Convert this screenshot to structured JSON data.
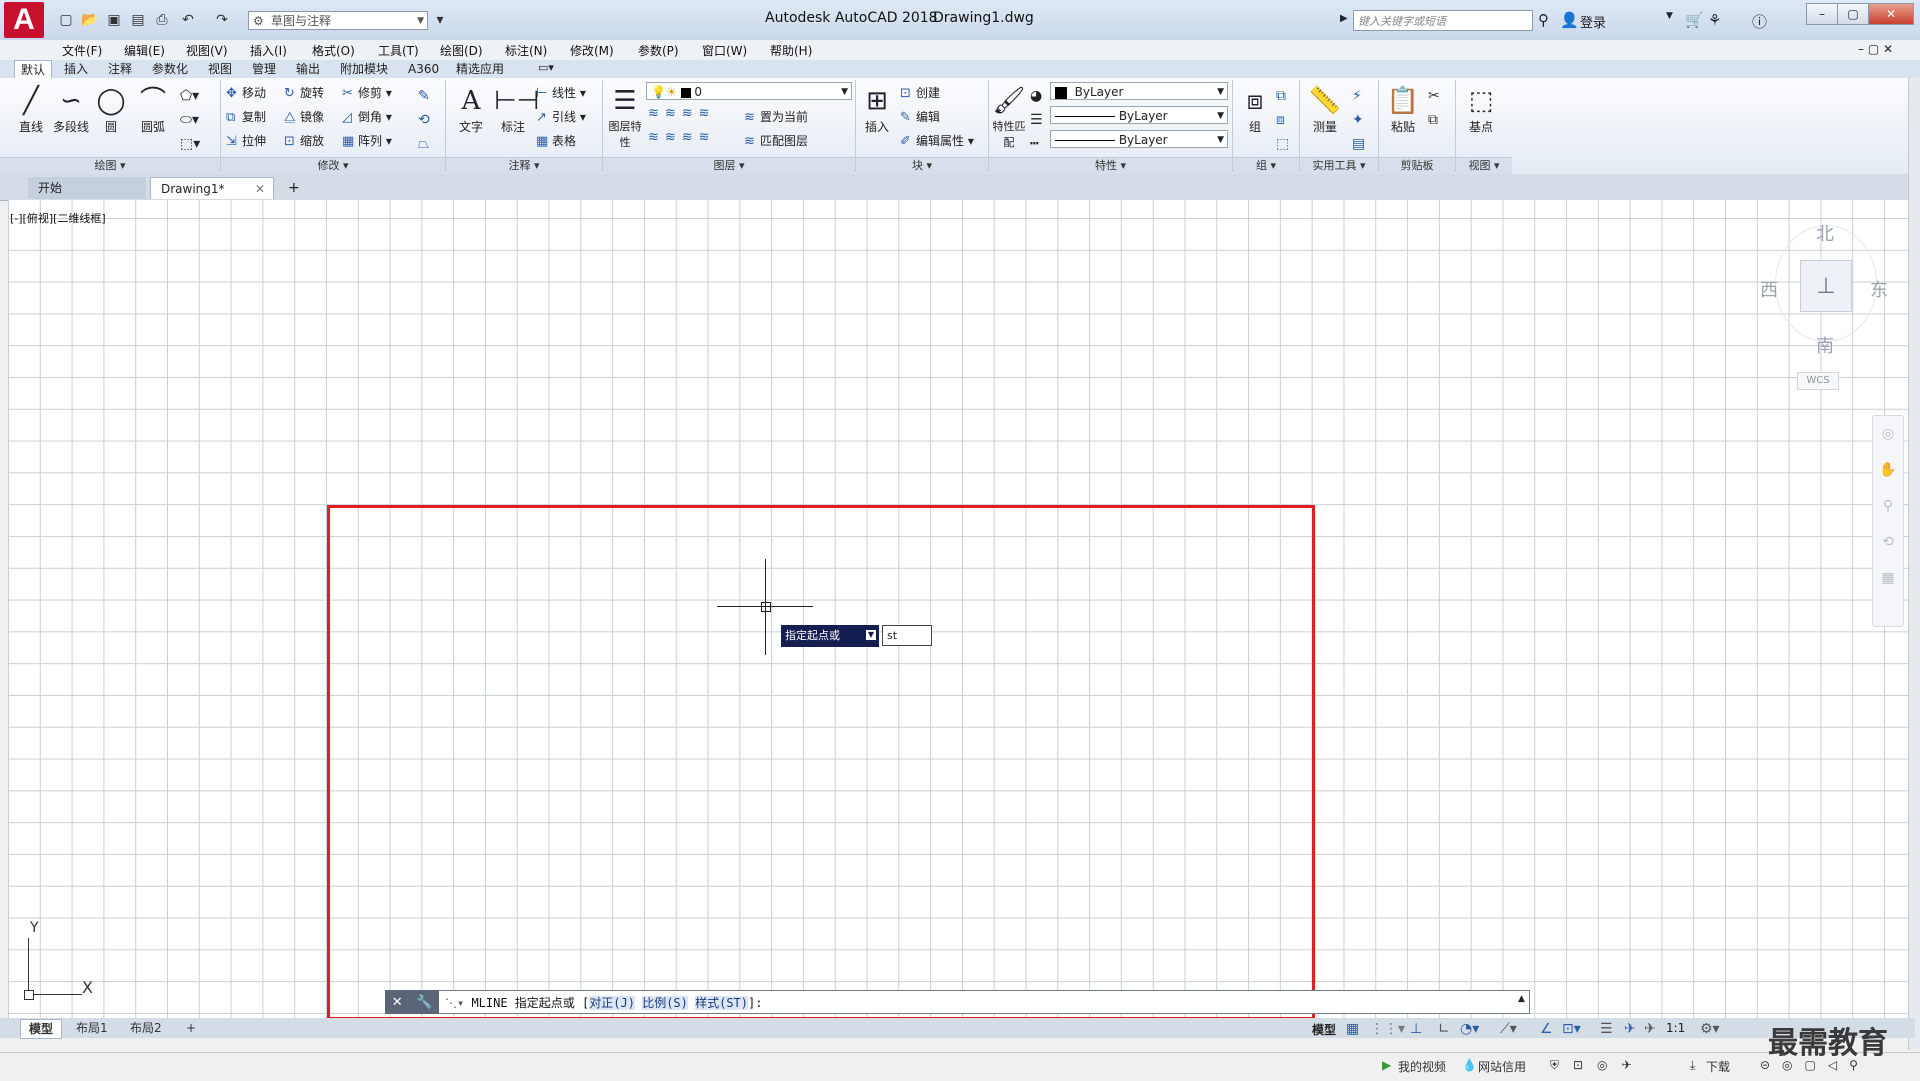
{
  "titlebar": {
    "logo": "A",
    "workspace": "草图与注释",
    "app_title": "Autodesk AutoCAD 2018",
    "doc_title": "Drawing1.dwg",
    "search_placeholder": "键入关键字或短语",
    "login": "登录"
  },
  "menus": [
    "文件(F)",
    "编辑(E)",
    "视图(V)",
    "插入(I)",
    "格式(O)",
    "工具(T)",
    "绘图(D)",
    "标注(N)",
    "修改(M)",
    "参数(P)",
    "窗口(W)",
    "帮助(H)"
  ],
  "ribbon_tabs": [
    "默认",
    "插入",
    "注释",
    "参数化",
    "视图",
    "管理",
    "输出",
    "附加模块",
    "A360",
    "精选应用"
  ],
  "ribbon": {
    "draw": {
      "label": "绘图",
      "tools": [
        "直线",
        "多段线",
        "圆",
        "圆弧"
      ]
    },
    "modify": {
      "label": "修改",
      "rows": [
        [
          "移动",
          "旋转",
          "修剪"
        ],
        [
          "复制",
          "镜像",
          "倒角"
        ],
        [
          "拉伸",
          "缩放",
          "阵列"
        ]
      ]
    },
    "annotation": {
      "label": "注释",
      "big": [
        "文字",
        "标注"
      ],
      "small": [
        "线性",
        "引线",
        "表格"
      ]
    },
    "layers": {
      "label": "图层",
      "big": "图层特性",
      "layer_value": "0",
      "small": [
        "置为当前",
        "匹配图层"
      ]
    },
    "block": {
      "label": "块",
      "big": "插入",
      "small": [
        "创建",
        "编辑",
        "编辑属性"
      ]
    },
    "properties": {
      "label": "特性",
      "big": "特性匹配",
      "color": "ByLayer",
      "linetype": "ByLayer",
      "lineweight": "ByLayer"
    },
    "groups": {
      "label": "组",
      "big": "组"
    },
    "utilities": {
      "label": "实用工具",
      "big": "测量"
    },
    "clipboard": {
      "label": "剪贴板",
      "big": "粘贴"
    },
    "view": {
      "label": "视图",
      "big": "基点"
    }
  },
  "file_tabs": {
    "start": "开始",
    "drawing": "Drawing1*",
    "add": "+"
  },
  "viewport_label": "[-][俯视][二维线框]",
  "viewcube": {
    "north": "北",
    "south": "南",
    "east": "东",
    "west": "西",
    "wcs": "WCS"
  },
  "prompt": {
    "tooltip": "指定起点或",
    "input": "st"
  },
  "ucs": {
    "x": "X",
    "y": "Y"
  },
  "command": {
    "prefix": "MLINE 指定起点或 [",
    "opt1": "对正(J)",
    "opt2": "比例(S)",
    "opt3": "样式(ST)",
    "suffix": "]:"
  },
  "layout_tabs": [
    "模型",
    "布局1",
    "布局2",
    "+"
  ],
  "status": {
    "model": "模型",
    "scale": "1:1"
  },
  "bottom": {
    "my_video": "我的视频",
    "credit": "网站信用",
    "download": "下载"
  },
  "watermark": "最需教育",
  "colors": {
    "accent": "#c8102e",
    "selection_box": "#e02020",
    "tooltip_bg": "#141e50"
  }
}
